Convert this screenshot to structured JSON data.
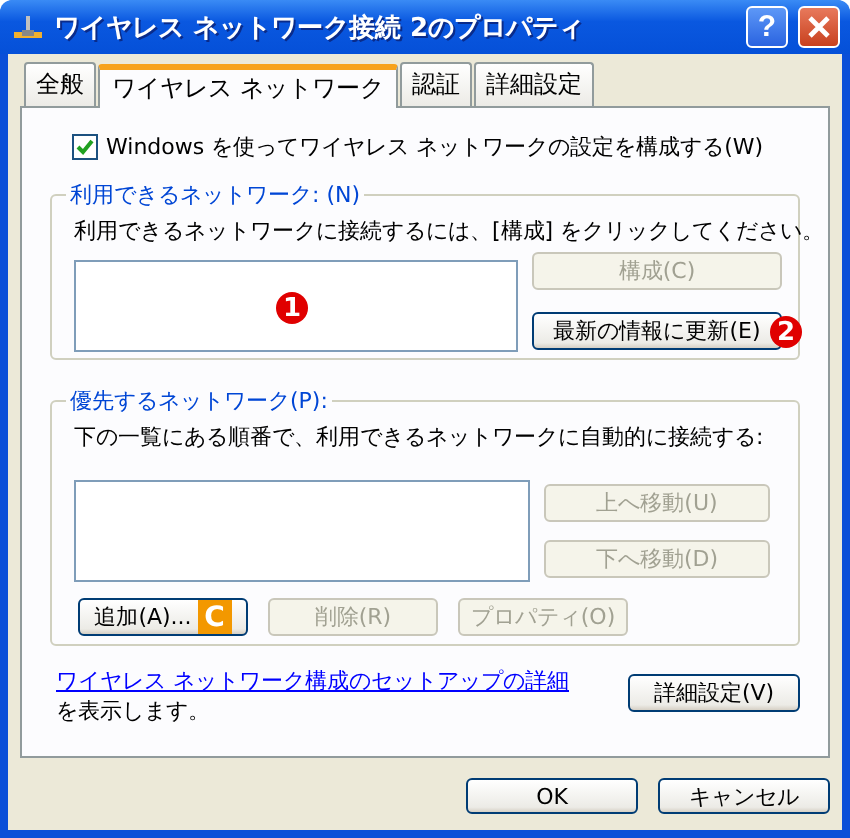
{
  "window": {
    "title": "ワイヤレス ネットワーク接続 2のプロパティ"
  },
  "title_buttons": [
    {
      "kind": "help",
      "label": "?"
    },
    {
      "kind": "close"
    }
  ],
  "tabs": [
    {
      "label": "全般",
      "selected": false
    },
    {
      "label": "ワイヤレス ネットワーク",
      "selected": true
    },
    {
      "label": "認証",
      "selected": false
    },
    {
      "label": "詳細設定",
      "selected": false
    }
  ],
  "use_windows_checkbox": {
    "label": "Windows を使ってワイヤレス ネットワークの設定を構成する(W)",
    "checked": true
  },
  "available_networks": {
    "title": "利用できるネットワーク: (N)",
    "description": "利用できるネットワークに接続するには、[構成] をクリックしてください。",
    "list_callout": {
      "kind": "circle",
      "label": "1"
    },
    "buttons": [
      {
        "label": "構成(C)",
        "disabled": true
      },
      {
        "label": "最新の情報に更新(E)",
        "disabled": false,
        "callout": {
          "kind": "circle",
          "label": "2"
        }
      }
    ]
  },
  "preferred_networks": {
    "title": "優先するネットワーク(P):",
    "description": "下の一覧にある順番で、利用できるネットワークに自動的に接続する:",
    "side_buttons": [
      {
        "label": "上へ移動(U)",
        "disabled": true
      },
      {
        "label": "下へ移動(D)",
        "disabled": true
      }
    ],
    "bottom_buttons": [
      {
        "label": "追加(A)...",
        "disabled": false,
        "callout": {
          "kind": "square",
          "label": "C"
        }
      },
      {
        "label": "削除(R)",
        "disabled": true
      },
      {
        "label": "プロパティ(O)",
        "disabled": true
      }
    ]
  },
  "help_link": {
    "link": "ワイヤレス ネットワーク構成のセットアップの詳細",
    "suffix": "を表示します。"
  },
  "advanced_button": {
    "label": "詳細設定(V)",
    "disabled": false
  },
  "footer_buttons": [
    {
      "label": "OK",
      "disabled": false
    },
    {
      "label": "キャンセル",
      "disabled": false
    }
  ]
}
